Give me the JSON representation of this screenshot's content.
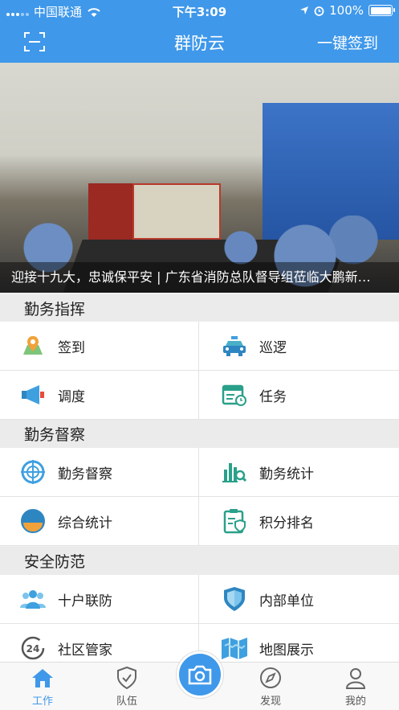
{
  "status_bar": {
    "carrier": "中国联通",
    "time": "下午3:09",
    "battery": "100%"
  },
  "nav": {
    "title": "群防云",
    "checkin": "一键签到"
  },
  "banner": {
    "caption": "迎接十九大，忠诚保平安 | 广东省消防总队督导组莅临大鹏新…"
  },
  "sections": {
    "duty_command": {
      "title": "勤务指挥",
      "items": [
        {
          "label": "签到",
          "icon": "map-pin-icon"
        },
        {
          "label": "巡逻",
          "icon": "police-car-icon"
        },
        {
          "label": "调度",
          "icon": "megaphone-icon"
        },
        {
          "label": "任务",
          "icon": "calendar-task-icon"
        }
      ]
    },
    "duty_supervision": {
      "title": "勤务督察",
      "items": [
        {
          "label": "勤务督察",
          "icon": "crosshair-icon"
        },
        {
          "label": "勤务统计",
          "icon": "bar-chart-search-icon"
        },
        {
          "label": "综合统计",
          "icon": "gauge-icon"
        },
        {
          "label": "积分排名",
          "icon": "clipboard-shield-icon"
        }
      ]
    },
    "safety": {
      "title": "安全防范",
      "items": [
        {
          "label": "十户联防",
          "icon": "people-group-icon"
        },
        {
          "label": "内部单位",
          "icon": "shield-icon"
        },
        {
          "label": "社区管家",
          "icon": "24h-icon"
        },
        {
          "label": "地图展示",
          "icon": "map-icon"
        }
      ]
    }
  },
  "tabs": [
    {
      "label": "工作",
      "icon": "home-icon",
      "active": true
    },
    {
      "label": "队伍",
      "icon": "shield-check-icon",
      "active": false
    },
    {
      "label": "发现",
      "icon": "compass-icon",
      "active": false
    },
    {
      "label": "我的",
      "icon": "person-icon",
      "active": false
    }
  ],
  "colors": {
    "primary": "#3f98ea"
  }
}
